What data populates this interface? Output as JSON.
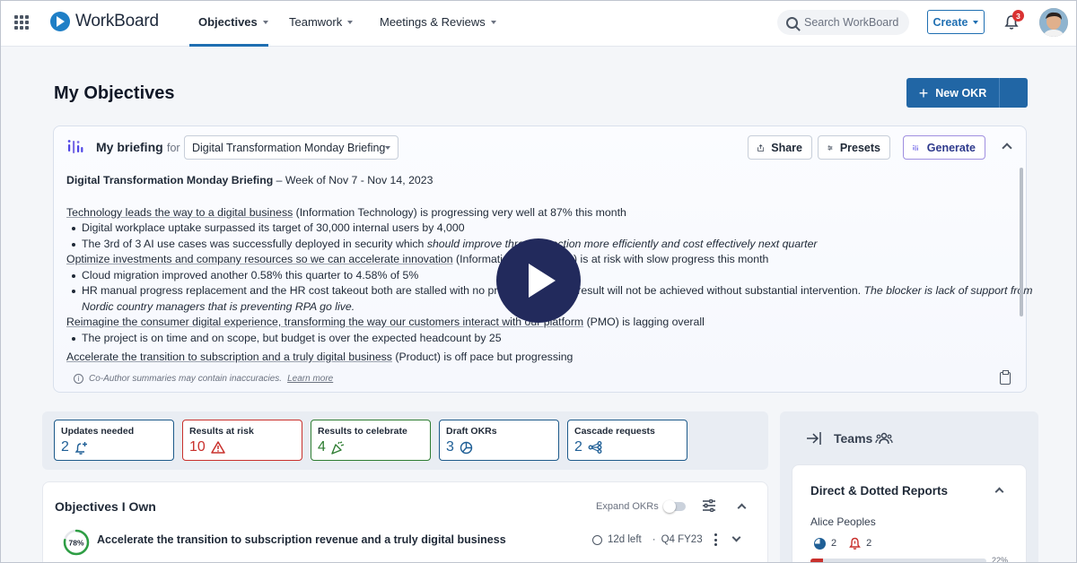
{
  "app": {
    "name": "WorkBoard"
  },
  "nav": {
    "items": [
      {
        "label": "Objectives"
      },
      {
        "label": "Teamwork"
      },
      {
        "label": "Meetings & Reviews"
      }
    ],
    "search_placeholder": "Search WorkBoard",
    "create_label": "Create",
    "notification_count": "3"
  },
  "page": {
    "title": "My Objectives",
    "new_okr_label": "New OKR"
  },
  "briefing": {
    "title": "My briefing",
    "for_label": "for",
    "selected": "Digital Transformation Monday Briefing",
    "share_label": "Share",
    "presets_label": "Presets",
    "generate_label": "Generate",
    "heading_bold": "Digital Transformation Monday Briefing",
    "heading_rest": " – Week of Nov 7 - Nov 14, 2023",
    "sections": [
      {
        "link": "Technology leads the way to a digital business",
        "rest": "  (Information Technology) is progressing very well at 87% this month",
        "bullets": [
          {
            "text": "Digital workplace uptake surpassed its target of 30,000 internal users by 4,000",
            "italic": ""
          },
          {
            "text": "The 3rd of 3 AI use cases was successfully deployed in security which ",
            "italic": "should improve threat detection more efficiently and cost effectively next quarter"
          }
        ]
      },
      {
        "link": "Optimize investments and company resources so we can accelerate innovation",
        "rest": " (Information Technology) is at risk with slow progress this month",
        "bullets": [
          {
            "text": "Cloud migration improved another 0.58% this quarter to 4.58% of 5%",
            "italic": ""
          },
          {
            "text": "HR manual progress replacement and the HR cost takeout both are stalled with no progress; this key result will not be achieved without substantial intervention.  ",
            "italic": "The blocker is lack of support from"
          },
          {
            "text": "",
            "italic": "Nordic country managers that is preventing RPA go live."
          }
        ]
      },
      {
        "link": "Reimagine the consumer digital experience, transforming the way our customers interact with our platform",
        "rest": " (PMO) is lagging overall",
        "bullets": [
          {
            "text": "The project is on time and on scope, but budget is over the expected headcount by 25",
            "italic": ""
          }
        ]
      },
      {
        "link": "Accelerate the transition to subscription and a truly digital business",
        "rest": " (Product) is off pace but progressing",
        "bullets": []
      }
    ],
    "disclaimer": "Co-Author summaries may contain inaccuracies.",
    "learn_more": "Learn more"
  },
  "stats": [
    {
      "label": "Updates needed",
      "value": "2",
      "color": "#1f5f96",
      "icon": "bell-plus-icon"
    },
    {
      "label": "Results at risk",
      "value": "10",
      "color": "#c9302c",
      "icon": "warning-icon"
    },
    {
      "label": "Results to celebrate",
      "value": "4",
      "color": "#2e7d32",
      "icon": "party-popper-icon"
    },
    {
      "label": "Draft OKRs",
      "value": "3",
      "color": "#1f5f96",
      "icon": "pie-draft-icon"
    },
    {
      "label": "Cascade requests",
      "value": "2",
      "color": "#1f5f96",
      "icon": "cascade-icon"
    }
  ],
  "objectives_own": {
    "title": "Objectives I Own",
    "expand_label": "Expand OKRs",
    "rows": [
      {
        "progress_label": "78%",
        "progress": 0.78,
        "name": "Accelerate the transition to subscription revenue and a truly digital business",
        "time_left": "12d left",
        "period": "Q4 FY23"
      }
    ]
  },
  "teams": {
    "title": "Teams",
    "reports_title": "Direct & Dotted Reports",
    "people": [
      {
        "name": "Alice Peoples",
        "pie_count": "2",
        "alert_count": "2",
        "bar_progress": 0.07,
        "pct_label": "22%"
      }
    ]
  },
  "colors": {
    "accent": "#1f6fb2",
    "primary_button": "#2166a5",
    "risk": "#c9302c",
    "celebrate": "#2e7d32",
    "play": "#222a5c"
  }
}
